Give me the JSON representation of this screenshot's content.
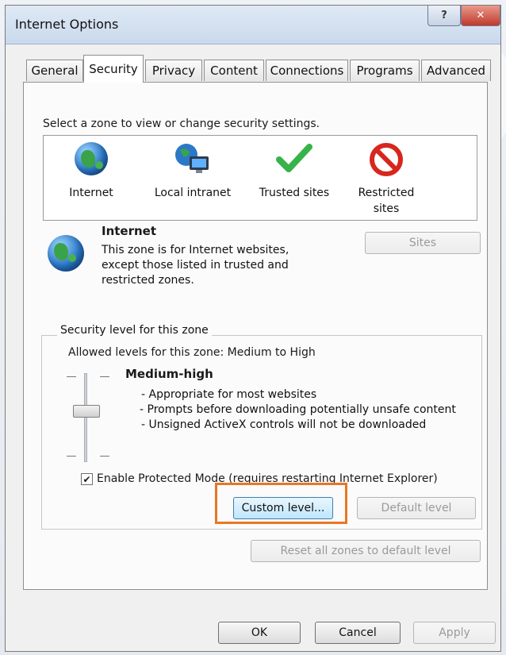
{
  "window": {
    "title": "Internet Options"
  },
  "titlebar": {
    "help_symbol": "?",
    "close_symbol": "✕"
  },
  "tabs": [
    {
      "label": "General"
    },
    {
      "label": "Security"
    },
    {
      "label": "Privacy"
    },
    {
      "label": "Content"
    },
    {
      "label": "Connections"
    },
    {
      "label": "Programs"
    },
    {
      "label": "Advanced"
    }
  ],
  "security": {
    "prompt": "Select a zone to view or change security settings.",
    "zones": [
      {
        "label": "Internet",
        "icon": "globe-icon"
      },
      {
        "label": "Local intranet",
        "icon": "intranet-icon"
      },
      {
        "label": "Trusted sites",
        "icon": "checkmark-icon"
      },
      {
        "label": "Restricted sites",
        "icon": "restricted-icon"
      }
    ],
    "selected_zone": {
      "name": "Internet",
      "description": "This zone is for Internet websites, except those listed in trusted and restricted zones."
    },
    "sites_button": "Sites",
    "level_legend": "Security level for this zone",
    "allowed_levels": "Allowed levels for this zone: Medium to High",
    "level_name": "Medium-high",
    "level_points": [
      "- Appropriate for most websites",
      "- Prompts before downloading potentially unsafe content",
      "- Unsigned ActiveX controls will not be downloaded"
    ],
    "protected_mode": {
      "checked": true,
      "label": "Enable Protected Mode (requires restarting Internet Explorer)"
    },
    "custom_level_button": "Custom level...",
    "default_level_button": "Default level",
    "reset_button": "Reset all zones to default level"
  },
  "footer": {
    "ok": "OK",
    "cancel": "Cancel",
    "apply": "Apply"
  },
  "colors": {
    "highlight": "#e87722",
    "close_button": "#c0392b"
  }
}
